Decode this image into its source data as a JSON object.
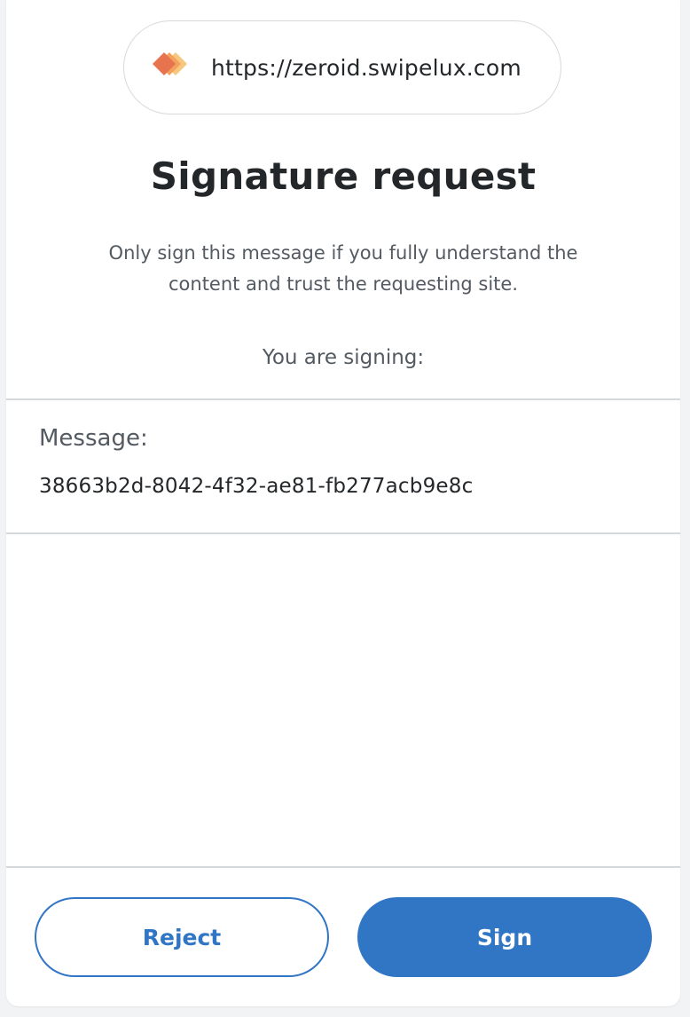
{
  "origin": {
    "url": "https://zeroid.swipelux.com",
    "icon": "site-favicon-icon"
  },
  "header": {
    "title": "Signature request",
    "warning": "Only sign this message if you fully understand the content and trust the requesting site.",
    "signing_label": "You are signing:"
  },
  "message": {
    "label": "Message:",
    "value": "38663b2d-8042-4f32-ae81-fb277acb9e8c"
  },
  "footer": {
    "reject_label": "Reject",
    "sign_label": "Sign"
  },
  "colors": {
    "primary": "#3076c5",
    "text": "#24272a",
    "muted": "#535a61",
    "border": "#d6d9dc",
    "icon_front": "#e8744f",
    "icon_mid": "#f4a15d",
    "icon_back": "#f7c77d"
  }
}
